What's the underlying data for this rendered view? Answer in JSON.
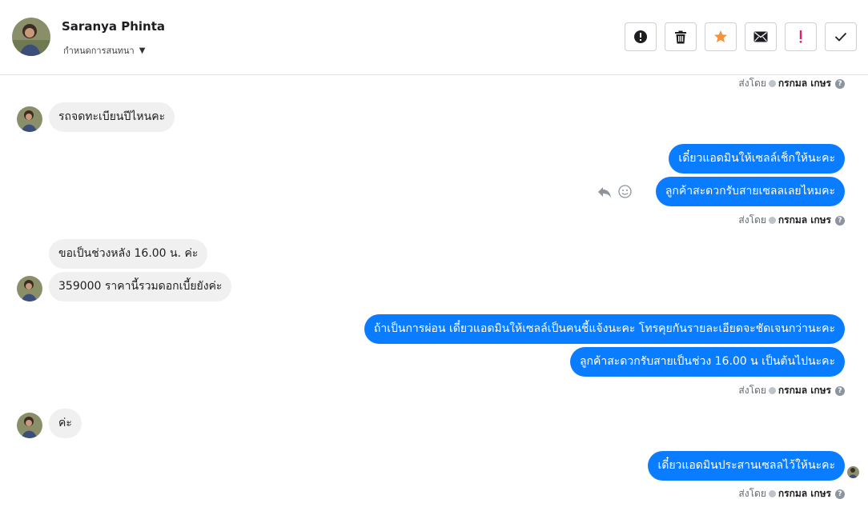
{
  "header": {
    "contact_name": "Saranya Phinta",
    "subtitle": "กำหนดการสนทนา",
    "toolbar": [
      {
        "name": "report-button",
        "icon": "alert-circle-icon"
      },
      {
        "name": "delete-button",
        "icon": "trash-icon"
      },
      {
        "name": "star-button",
        "icon": "star-icon"
      },
      {
        "name": "mark-unread-button",
        "icon": "envelope-icon"
      },
      {
        "name": "priority-button",
        "icon": "exclamation-icon"
      },
      {
        "name": "mark-done-button",
        "icon": "check-icon"
      }
    ]
  },
  "sent_by": {
    "prefix": "ส่งโดย",
    "agent": "กรกมล เกษร"
  },
  "messages": {
    "m1": "รถจดทะเบียนปีไหนคะ",
    "m2": "เดี๋ยวแอดมินให้เซลล์เช็กให้นะคะ",
    "m3": "ลูกค้าสะดวกรับสายเซลลเลยไหมคะ",
    "m4": "ขอเป็นช่วงหลัง 16.00 น. ค่ะ",
    "m5": "359000 ราคานี้รวมดอกเบี้ยยังค่ะ",
    "m6": "ถ้าเป็นการผ่อน เดี๋ยวแอดมินให้เซลล์เป็นคนชี้แจ้งนะคะ  โทรคุยกันรายละเอียดจะชัดเจนกว่านะคะ",
    "m7": "ลูกค้าสะดวกรับสายเป็นช่วง 16.00 น เป็นต้นไปนะคะ",
    "m8": "ค่ะ",
    "m9": "เดี๋ยวแอดมินประสานเซลลไว้ให้นะคะ"
  },
  "colors": {
    "outgoing": "#0a7cff",
    "incoming": "#f1f0f0",
    "star": "#f7923a",
    "priority": "#e0245e"
  }
}
